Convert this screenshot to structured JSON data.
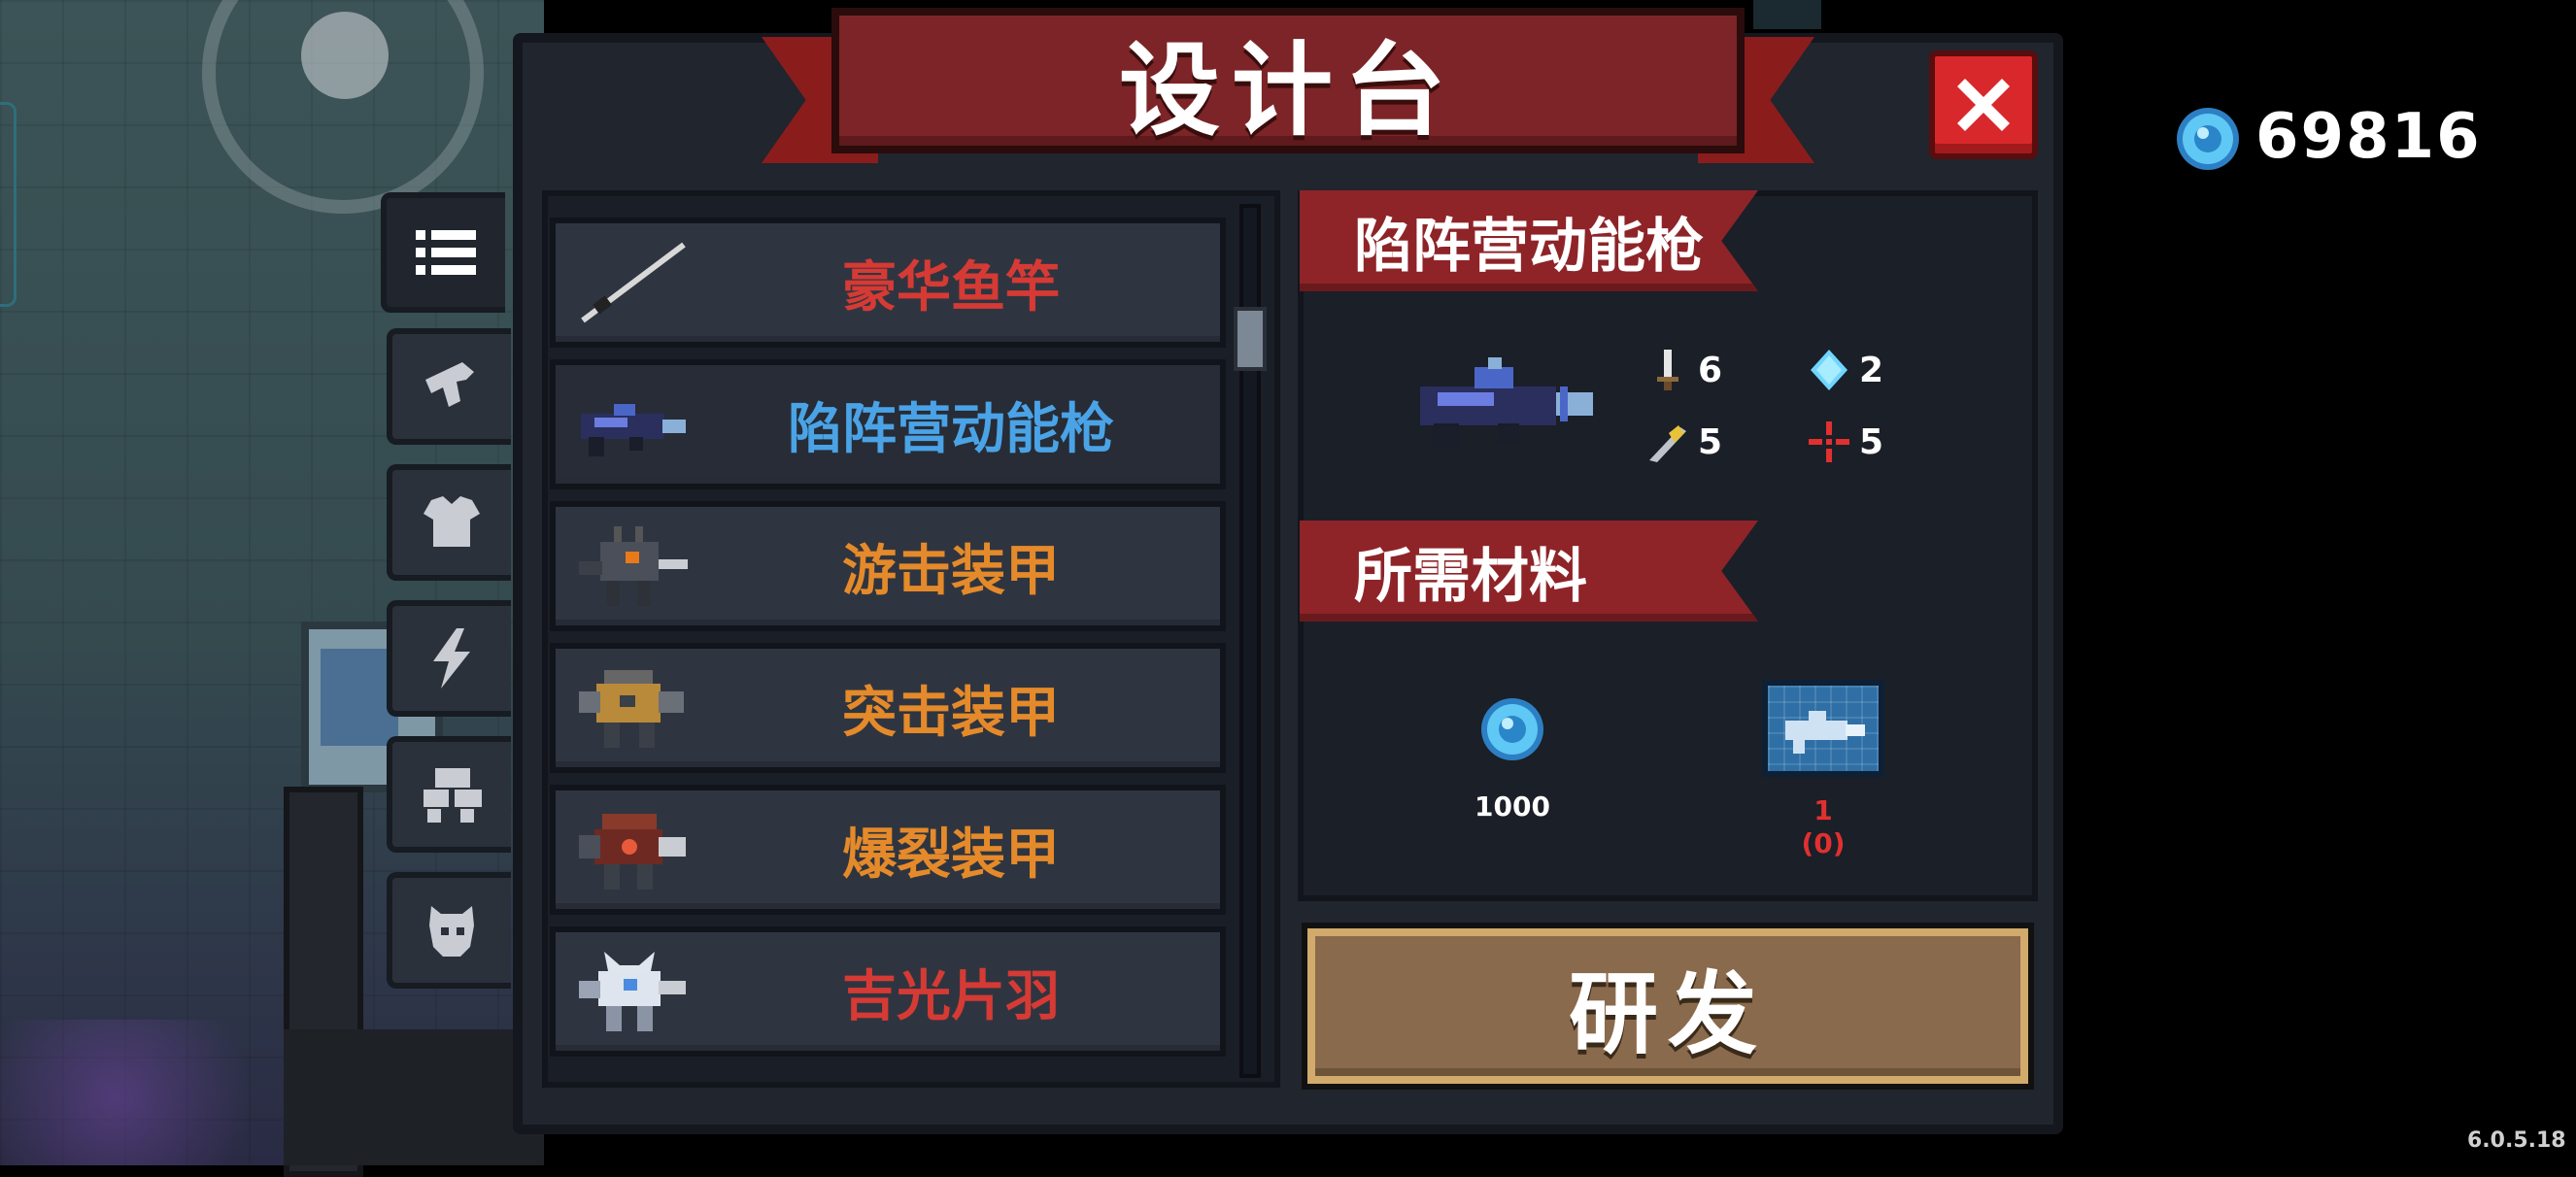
{
  "title": "设计台",
  "currency": {
    "icon": "gem-icon",
    "amount": "69816"
  },
  "tabs": [
    {
      "icon": "list-icon",
      "active": true
    },
    {
      "icon": "gun-icon",
      "active": false
    },
    {
      "icon": "armor-icon",
      "active": false
    },
    {
      "icon": "lightning-icon",
      "active": false
    },
    {
      "icon": "mech-icon",
      "active": false
    },
    {
      "icon": "pet-icon",
      "active": false
    }
  ],
  "list": [
    {
      "label": "豪华鱼竿",
      "color": "#d63a34",
      "icon": "fishing-rod-icon",
      "selected": false
    },
    {
      "label": "陷阵营动能枪",
      "color": "#4aa3e6",
      "icon": "kinetic-gun-icon",
      "selected": true
    },
    {
      "label": "游击装甲",
      "color": "#e58a2a",
      "icon": "guerrilla-mech-icon",
      "selected": false
    },
    {
      "label": "突击装甲",
      "color": "#e58a2a",
      "icon": "assault-mech-icon",
      "selected": false
    },
    {
      "label": "爆裂装甲",
      "color": "#e58a2a",
      "icon": "burst-mech-icon",
      "selected": false
    },
    {
      "label": "吉光片羽",
      "color": "#d63a34",
      "icon": "white-mech-icon",
      "selected": false
    }
  ],
  "detail": {
    "name": "陷阵营动能枪",
    "stats": [
      {
        "icon": "damage-icon",
        "value": "6"
      },
      {
        "icon": "energy-icon",
        "value": "2"
      },
      {
        "icon": "critical-icon",
        "value": "5"
      },
      {
        "icon": "accuracy-icon",
        "value": "5"
      }
    ],
    "materials_label": "所需材料",
    "materials": [
      {
        "icon": "gem-icon",
        "qty": "1000"
      },
      {
        "icon": "blueprint-icon",
        "qty": "1",
        "owned": "(0)"
      }
    ],
    "craft_label": "研发"
  },
  "version": "6.0.5.18"
}
